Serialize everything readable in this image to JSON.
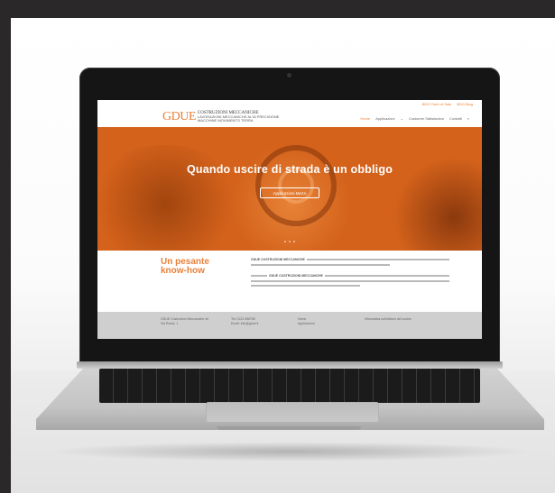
{
  "site": {
    "topbar_links": [
      "BDO Point of Sale",
      "BDO Blog"
    ],
    "logo": {
      "mark": "GDUE",
      "name_line": "COSTRUZIONI MECCANICHE",
      "tagline_1": "LAVORAZIONI MECCANICHE ALTA PRECISIONE",
      "tagline_2": "MACCHINE MOVIMENTO TERRA"
    },
    "nav": [
      "Home",
      "Applicazioni",
      "Customer Satisfaction",
      "Contatti"
    ],
    "hero": {
      "title": "Quando uscire di strada è un obbligo",
      "button": "Applicazioni Mezzi"
    },
    "content": {
      "title_line1": "Un pesante",
      "title_line2": "know-how",
      "intro_bold": "GDUE COSTRUZIONI MECCANICHE",
      "para2_bold": "GDUE COSTRUZIONI MECCANICHE"
    },
    "footer": {
      "col1": [
        "GDUE Costruzioni Meccaniche srl",
        "Via Roma, 1"
      ],
      "col2": [
        "Tel: 0123 456789",
        "Email: info@gdue.it"
      ],
      "col3": [
        "Home",
        "Applicazioni"
      ],
      "col4": [
        "Informativa sull'utilizzo dei cookie"
      ]
    }
  },
  "colors": {
    "accent": "#e8803a",
    "hero": "#d4621b",
    "footer": "#cfcfcf"
  }
}
